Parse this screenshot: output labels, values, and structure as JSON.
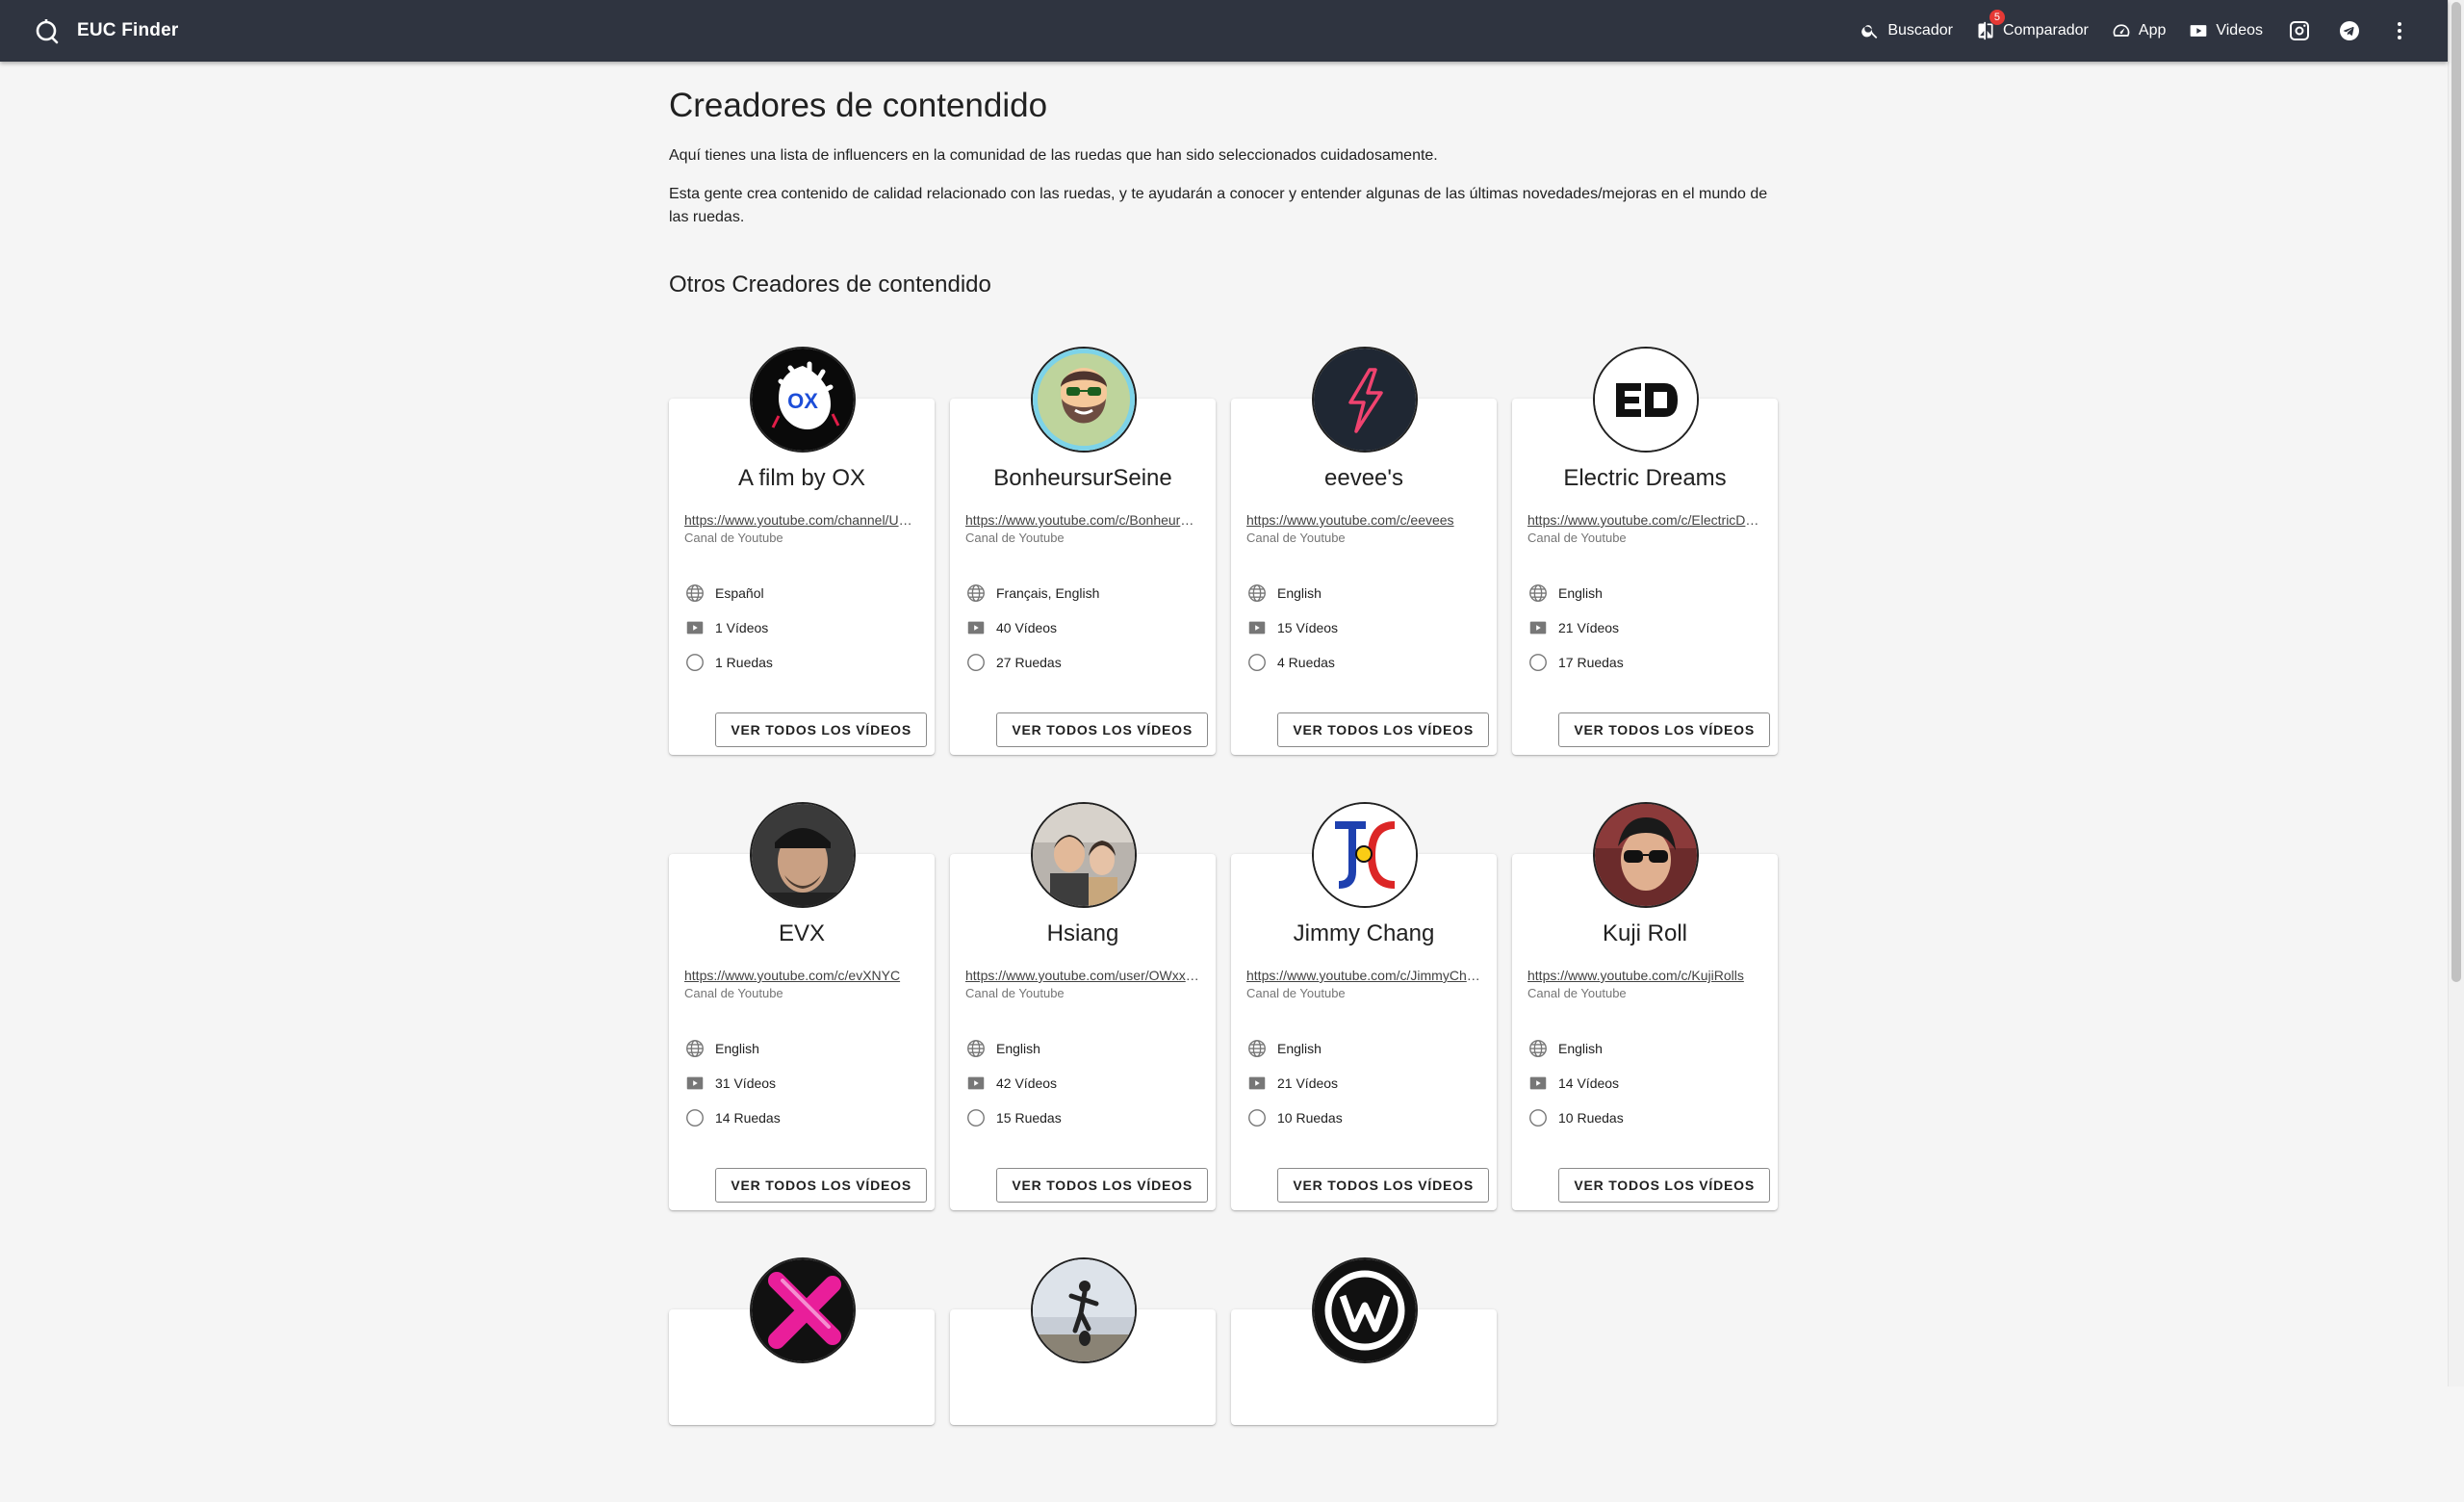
{
  "appbar": {
    "title": "EUC Finder",
    "nav": [
      {
        "label": "Buscador",
        "icon": "search-icon"
      },
      {
        "label": "Comparador",
        "icon": "compare-icon",
        "badge": "5"
      },
      {
        "label": "App",
        "icon": "speedometer-icon"
      },
      {
        "label": "Videos",
        "icon": "youtube-icon"
      }
    ],
    "social_icons": [
      "instagram-icon",
      "telegram-icon",
      "more-vert-icon"
    ]
  },
  "page": {
    "title": "Creadores de contendido",
    "intro1": "Aquí tienes una lista de influencers en la comunidad de las ruedas que han sido seleccionados cuidadosamente.",
    "intro2": "Esta gente crea contenido de calidad relacionado con las ruedas, y te ayudarán a conocer y entender algunas de las últimas novedades/mejoras en el mundo de las ruedas.",
    "section_title": "Otros Creadores de contendido"
  },
  "cards": [
    {
      "name": "A film by OX",
      "url": "https://www.youtube.com/channel/UCxxxxxxxxxxxx",
      "subtitle": "Canal de Youtube",
      "language": "Español",
      "videos": "1 Vídeos",
      "wheels": "1 Ruedas",
      "button": "VER TODOS LOS VÍDEOS",
      "avatar": "ox-logo"
    },
    {
      "name": "BonheursurSeine",
      "url": "https://www.youtube.com/c/BonheursurSeine",
      "subtitle": "Canal de Youtube",
      "language": "Français, English",
      "videos": "40 Vídeos",
      "wheels": "27 Ruedas",
      "button": "VER TODOS LOS VÍDEOS",
      "avatar": "bearded-cartoon"
    },
    {
      "name": "eevee's",
      "url": "https://www.youtube.com/c/eevees",
      "subtitle": "Canal de Youtube",
      "language": "English",
      "videos": "15 Vídeos",
      "wheels": "4 Ruedas",
      "button": "VER TODOS LOS VÍDEOS",
      "avatar": "lightning-logo"
    },
    {
      "name": "Electric Dreams",
      "url": "https://www.youtube.com/c/ElectricDreams",
      "subtitle": "Canal de Youtube",
      "language": "English",
      "videos": "21 Vídeos",
      "wheels": "17 Ruedas",
      "button": "VER TODOS LOS VÍDEOS",
      "avatar": "ed-logo"
    },
    {
      "name": "EVX",
      "url": "https://www.youtube.com/c/evXNYC",
      "subtitle": "Canal de Youtube",
      "language": "English",
      "videos": "31 Vídeos",
      "wheels": "14 Ruedas",
      "button": "VER TODOS LOS VÍDEOS",
      "avatar": "man-cap-photo"
    },
    {
      "name": "Hsiang",
      "url": "https://www.youtube.com/user/OWxxxxxxxx",
      "subtitle": "Canal de Youtube",
      "language": "English",
      "videos": "42 Vídeos",
      "wheels": "15 Ruedas",
      "button": "VER TODOS LOS VÍDEOS",
      "avatar": "couple-photo"
    },
    {
      "name": "Jimmy Chang",
      "url": "https://www.youtube.com/c/JimmyChang",
      "subtitle": "Canal de Youtube",
      "language": "English",
      "videos": "21 Vídeos",
      "wheels": "10 Ruedas",
      "button": "VER TODOS LOS VÍDEOS",
      "avatar": "jc-logo"
    },
    {
      "name": "Kuji Roll",
      "url": "https://www.youtube.com/c/KujiRolls",
      "subtitle": "Canal de Youtube",
      "language": "English",
      "videos": "14 Vídeos",
      "wheels": "10 Ruedas",
      "button": "VER TODOS LOS VÍDEOS",
      "avatar": "sunglasses-photo"
    }
  ],
  "partial_cards": [
    {
      "avatar": "pink-x-logo"
    },
    {
      "avatar": "rider-photo"
    },
    {
      "avatar": "w-logo"
    }
  ]
}
